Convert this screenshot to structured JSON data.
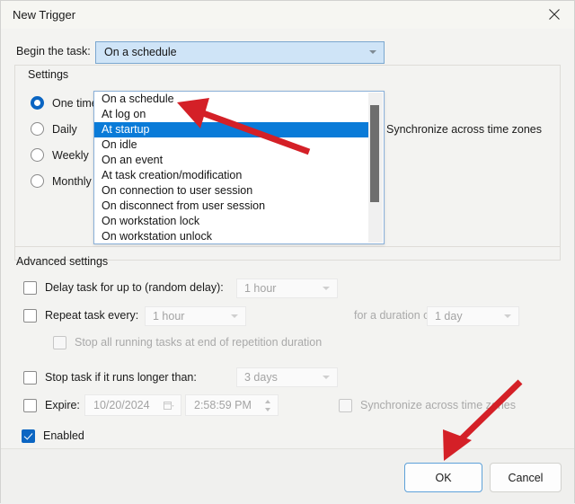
{
  "window": {
    "title": "New Trigger",
    "close_icon": "close-icon"
  },
  "begin": {
    "label": "Begin the task:",
    "selected": "On a schedule",
    "arrow_icon": "chevron-down-icon",
    "options": [
      "On a schedule",
      "At log on",
      "At startup",
      "On idle",
      "On an event",
      "At task creation/modification",
      "On connection to user session",
      "On disconnect from user session",
      "On workstation lock",
      "On workstation unlock"
    ],
    "highlighted_option": "At startup"
  },
  "settings": {
    "group_title": "Settings",
    "radios": [
      {
        "label": "One time",
        "checked": true
      },
      {
        "label": "Daily",
        "checked": false
      },
      {
        "label": "Weekly",
        "checked": false
      },
      {
        "label": "Monthly",
        "checked": false
      }
    ],
    "sync_label": "Synchronize across time zones"
  },
  "advanced": {
    "group_title": "Advanced settings",
    "delay": {
      "label": "Delay task for up to (random delay):",
      "checked": false,
      "value": "1 hour"
    },
    "repeat": {
      "label": "Repeat task every:",
      "checked": false,
      "value": "1 hour",
      "duration_label": "for a duration of:",
      "duration_value": "1 day"
    },
    "stop_all": {
      "label": "Stop all running tasks at end of repetition duration",
      "checked": false
    },
    "stop_task": {
      "label": "Stop task if it runs longer than:",
      "checked": false,
      "value": "3 days"
    },
    "expire": {
      "label": "Expire:",
      "checked": false,
      "date": "10/20/2024",
      "time": "2:58:59 PM",
      "sync_label": "Synchronize across time zones",
      "sync_checked": false,
      "calendar_icon": "calendar-icon",
      "spinner_icon": "spinner-updown-icon"
    },
    "enabled": {
      "label": "Enabled",
      "checked": true
    }
  },
  "footer": {
    "ok_label": "OK",
    "cancel_label": "Cancel"
  },
  "annotations": {
    "arrow_color": "#d42027",
    "arrow_to_startup": "red-arrow-pointing-to-at-startup",
    "arrow_to_ok": "red-arrow-pointing-to-ok-button"
  }
}
